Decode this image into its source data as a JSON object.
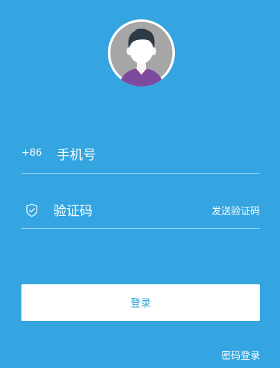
{
  "colors": {
    "background": "#34a5e0",
    "button_bg": "#ffffff",
    "button_text": "#34a5e0",
    "avatar_shirt": "#7e4a9e",
    "avatar_hair": "#2e3a46",
    "avatar_inner_bg": "#a6a6a6"
  },
  "avatar": {
    "icon": "user-avatar-icon"
  },
  "phone_field": {
    "country_code": "+86",
    "placeholder": "手机号",
    "value": ""
  },
  "code_field": {
    "icon": "shield-icon",
    "placeholder": "验证码",
    "value": "",
    "send_code_label": "发送验证码"
  },
  "login_button": {
    "label": "登录"
  },
  "password_login_link": {
    "label": "密码登录"
  }
}
